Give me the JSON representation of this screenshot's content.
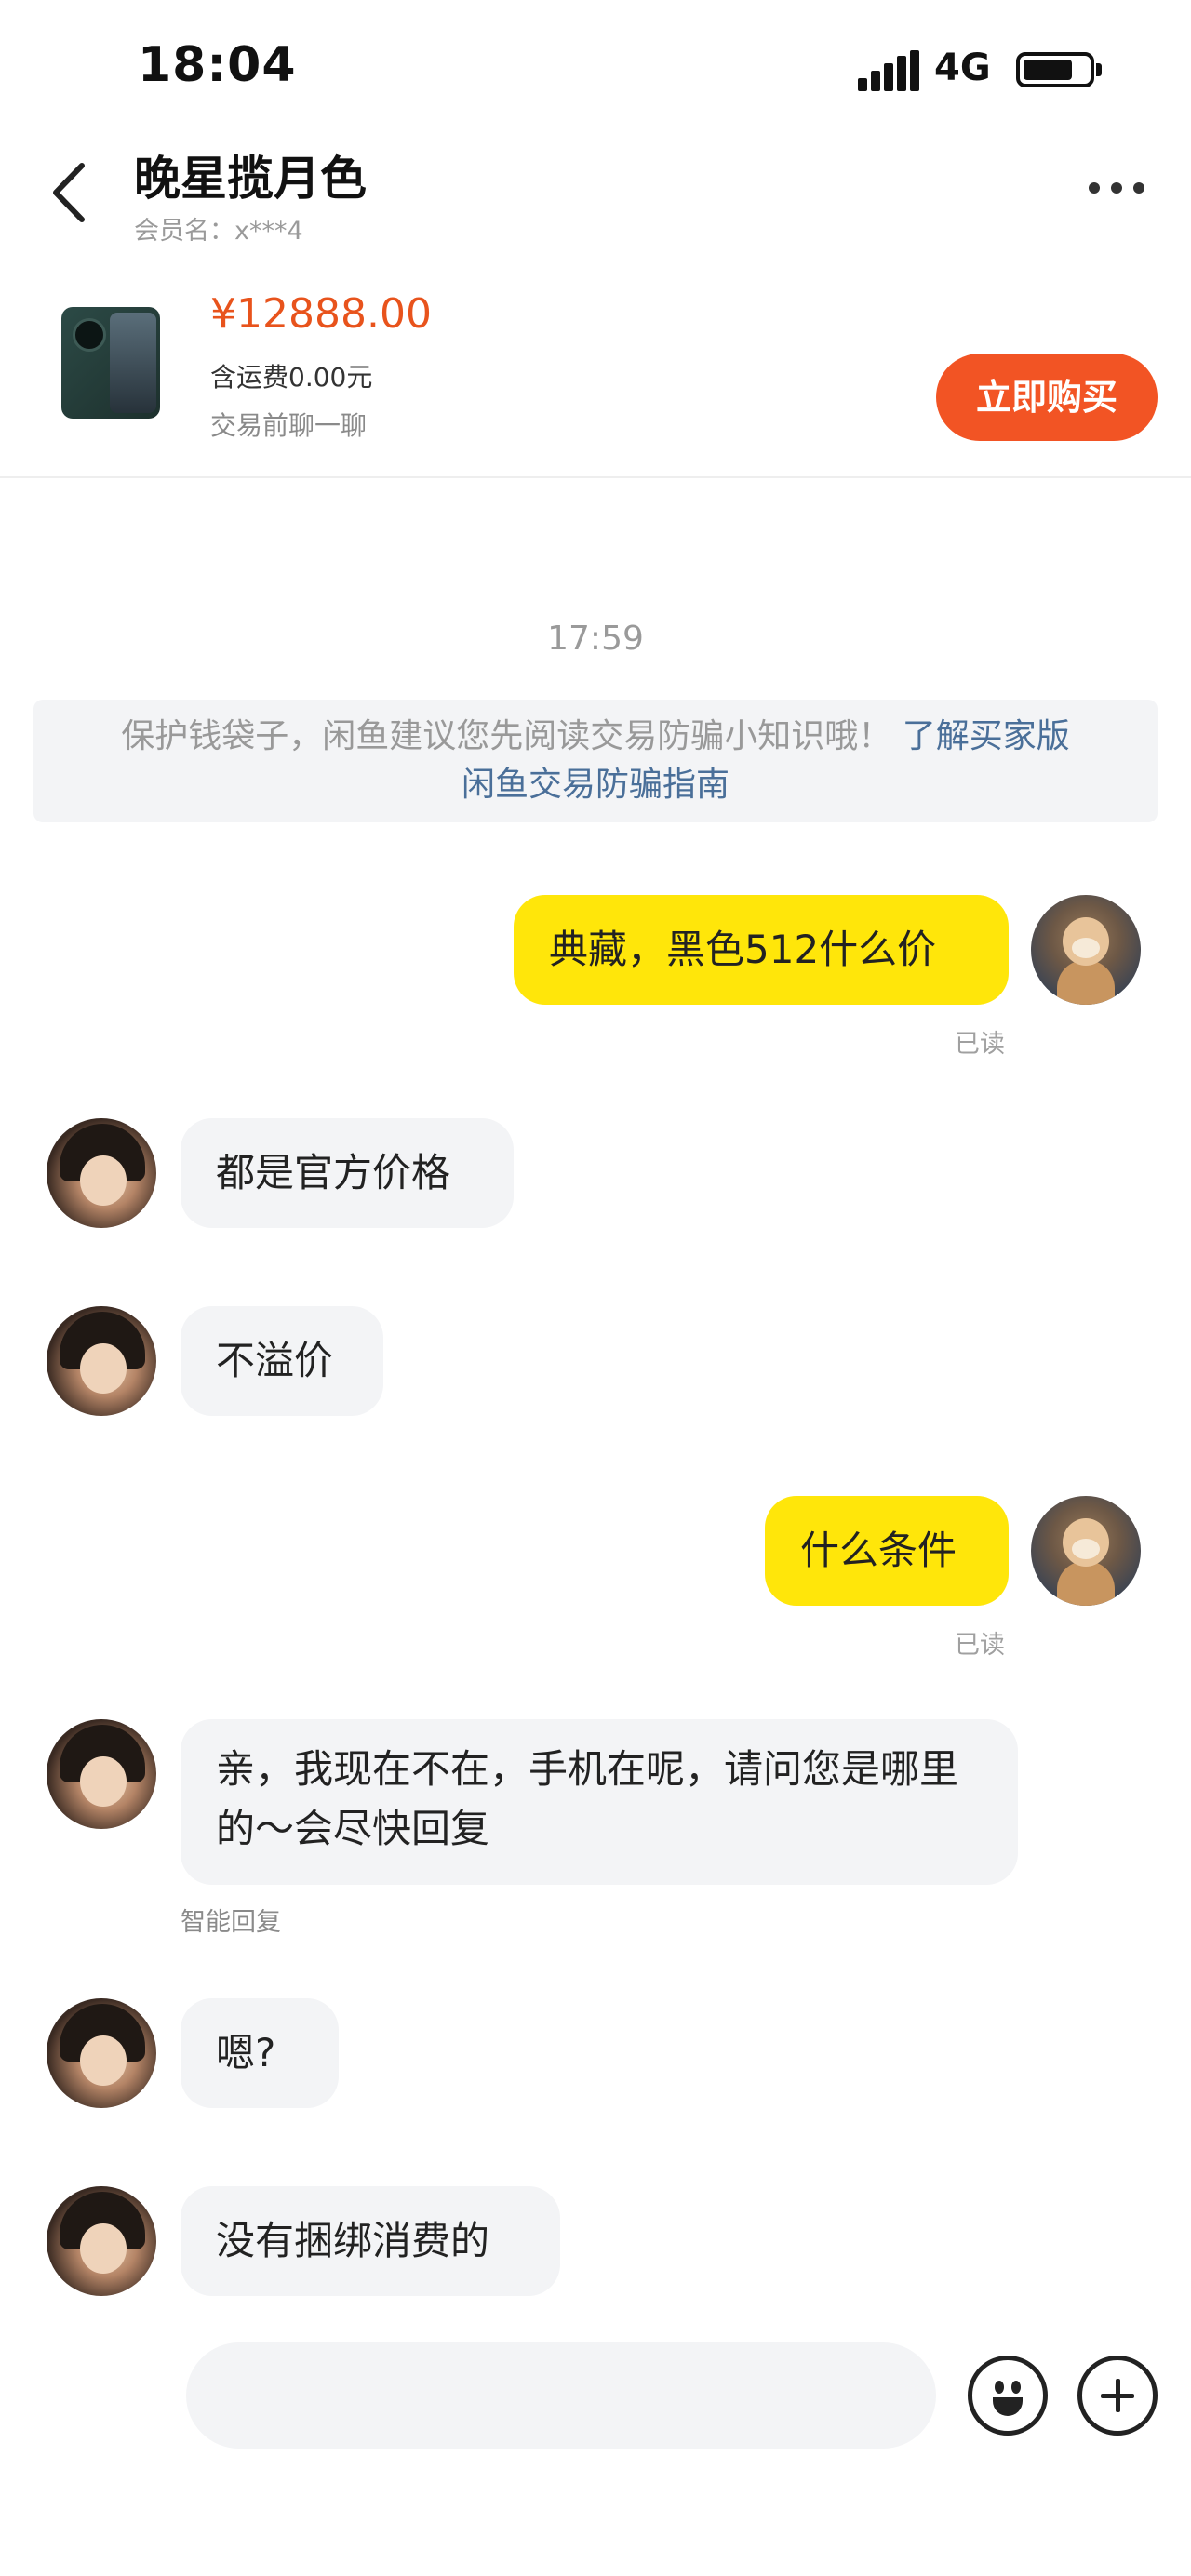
{
  "status_bar": {
    "time": "18:04",
    "network": "4G"
  },
  "header": {
    "title": "晚星揽月色",
    "member": "会员名：x***4"
  },
  "product": {
    "price": "¥12888.00",
    "shipping": "含运费0.00元",
    "prompt": "交易前聊一聊",
    "buy_label": "立即购买"
  },
  "chat": {
    "timestamp": "17:59",
    "notice": {
      "text": "保护钱袋子，闲鱼建议您先阅读交易防骗小知识哦！",
      "link_line1": "了解买家版",
      "link_line2": "闲鱼交易防骗指南"
    },
    "messages": [
      {
        "from": "me",
        "text": "典藏，黑色512什么价",
        "status": "已读"
      },
      {
        "from": "seller",
        "text": "都是官方价格"
      },
      {
        "from": "seller",
        "text": "不溢价"
      },
      {
        "from": "me",
        "text": "什么条件",
        "status": "已读"
      },
      {
        "from": "seller",
        "text": "亲，我现在不在，手机在呢，请问您是哪里的～会尽快回复",
        "note": "智能回复"
      },
      {
        "from": "seller",
        "text": "嗯?"
      },
      {
        "from": "seller",
        "text": "没有捆绑消费的"
      }
    ]
  },
  "input": {
    "value": ""
  },
  "icons": {
    "emoji": "emoji-icon",
    "plus": "plus-icon"
  },
  "colors": {
    "accent": "#f25424",
    "my_bubble": "#ffe60a",
    "their_bubble": "#f3f4f6",
    "link": "#4a6f99"
  }
}
